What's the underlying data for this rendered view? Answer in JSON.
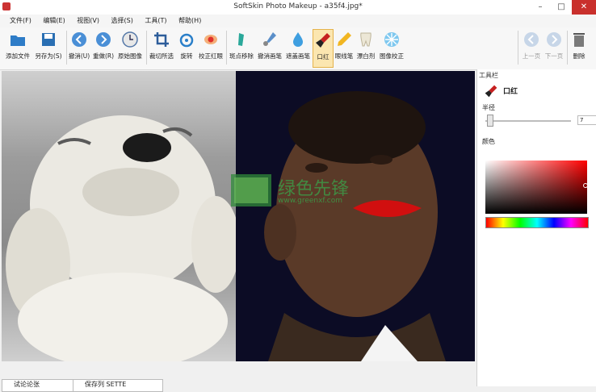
{
  "window": {
    "title": "SoftSkin Photo Makeup - a35f4.jpg*",
    "min": "–",
    "max": "□",
    "close": "✕"
  },
  "menu": [
    "文件(F)",
    "编辑(E)",
    "视图(V)",
    "选择(S)",
    "工具(T)",
    "帮助(H)"
  ],
  "toolbar": {
    "add_file": "添加文件",
    "save_as": "另存为(S)",
    "undo": "撤消(U)",
    "redo": "重做(R)",
    "original": "原始图像",
    "crop": "裁切所选",
    "rotate": "旋转",
    "red_eye": "校正红眼",
    "spot_removal": "斑点移除",
    "undo_brush": "撤消画笔",
    "smear_brush": "遮盖画笔",
    "lipstick": "口红",
    "eyeliner": "眼线笔",
    "teeth_whitening": "漂白剂",
    "image_correction": "图像校正",
    "prev_page": "上一页",
    "next_page": "下一页",
    "delete": "删除"
  },
  "tool_panel": {
    "title": "工具栏",
    "current_tool": "口红",
    "radius_label": "半径",
    "radius_value": "7",
    "color_label": "颜色"
  },
  "watermark": {
    "main": "绿色先锋",
    "url": "www.greenxf.com"
  },
  "status": {
    "btn1": "试论论张",
    "btn2": "保存列 SETTE"
  },
  "colors": {
    "accent": "#e5b34c",
    "lipstick": "#d10f0f",
    "close_btn": "#c9302c"
  }
}
